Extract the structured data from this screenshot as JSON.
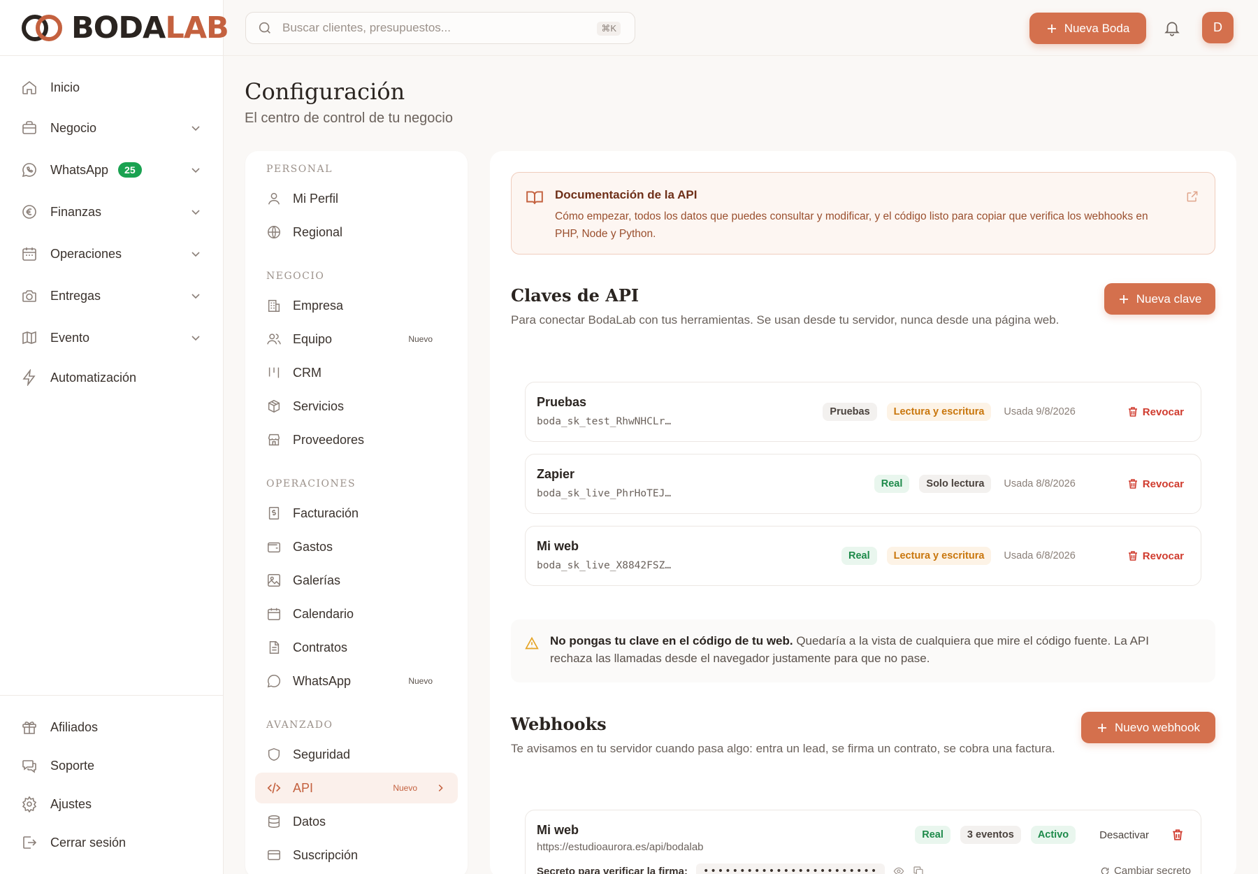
{
  "brand": {
    "name_part1": "BODA",
    "name_part2": "LAB",
    "accent": "#d4704d"
  },
  "search": {
    "placeholder": "Buscar clientes, presupuestos...",
    "shortcut": "⌘K"
  },
  "topbar": {
    "new_wedding_label": "Nueva Boda",
    "avatar_initial": "D"
  },
  "sidebar": {
    "items": [
      {
        "label": "Inicio",
        "icon": "home-icon"
      },
      {
        "label": "Negocio",
        "icon": "briefcase-icon"
      },
      {
        "label": "WhatsApp",
        "icon": "whatsapp-icon",
        "badge": "25"
      },
      {
        "label": "Finanzas",
        "icon": "euro-icon"
      },
      {
        "label": "Operaciones",
        "icon": "calendar-icon"
      },
      {
        "label": "Entregas",
        "icon": "camera-icon"
      },
      {
        "label": "Evento",
        "icon": "map-icon"
      },
      {
        "label": "Automatización",
        "icon": "bolt-icon"
      }
    ],
    "bottom": [
      {
        "label": "Afiliados",
        "icon": "gift-icon"
      },
      {
        "label": "Soporte",
        "icon": "support-icon"
      },
      {
        "label": "Ajustes",
        "icon": "gear-icon"
      },
      {
        "label": "Cerrar sesión",
        "icon": "logout-icon"
      }
    ]
  },
  "page": {
    "title": "Configuración",
    "subtitle": "El centro de control de tu negocio"
  },
  "settings_nav": {
    "sections": [
      {
        "title": "PERSONAL",
        "items": [
          {
            "label": "Mi Perfil"
          },
          {
            "label": "Regional"
          }
        ]
      },
      {
        "title": "NEGOCIO",
        "items": [
          {
            "label": "Empresa"
          },
          {
            "label": "Equipo",
            "tag": "Nuevo"
          },
          {
            "label": "CRM"
          },
          {
            "label": "Servicios"
          },
          {
            "label": "Proveedores"
          }
        ]
      },
      {
        "title": "OPERACIONES",
        "items": [
          {
            "label": "Facturación"
          },
          {
            "label": "Gastos"
          },
          {
            "label": "Galerías"
          },
          {
            "label": "Calendario"
          },
          {
            "label": "Contratos"
          },
          {
            "label": "WhatsApp",
            "tag": "Nuevo"
          }
        ]
      },
      {
        "title": "AVANZADO",
        "items": [
          {
            "label": "Seguridad"
          },
          {
            "label": "API",
            "tag": "Nuevo"
          },
          {
            "label": "Datos"
          },
          {
            "label": "Suscripción"
          }
        ]
      }
    ]
  },
  "doc_banner": {
    "title": "Documentación de la API",
    "description": "Cómo empezar, todos los datos que puedes consultar y modificar, y el código listo para copiar que verifica los webhooks en PHP, Node y Python."
  },
  "api_keys": {
    "title": "Claves de API",
    "description": "Para conectar BodaLab con tus herramientas. Se usan desde tu servidor, nunca desde una página web.",
    "new_label": "Nueva clave",
    "revoke_label": "Revocar",
    "items": [
      {
        "name": "Pruebas",
        "key": "boda_sk_test_RhwNHCLr…",
        "env": "Pruebas",
        "scope": "Lectura y escritura",
        "used": "Usada 9/8/2026"
      },
      {
        "name": "Zapier",
        "key": "boda_sk_live_PhrHoTEJ…",
        "env": "Real",
        "scope": "Solo lectura",
        "used": "Usada 8/8/2026"
      },
      {
        "name": "Mi web",
        "key": "boda_sk_live_X8842FSZ…",
        "env": "Real",
        "scope": "Lectura y escritura",
        "used": "Usada 6/8/2026"
      }
    ]
  },
  "warning": {
    "bold": "No pongas tu clave en el código de tu web.",
    "text": " Quedaría a la vista de cualquiera que mire el código fuente. La API rechaza las llamadas desde el navegador justamente para que no pase."
  },
  "webhooks": {
    "title": "Webhooks",
    "description": "Te avisamos en tu servidor cuando pasa algo: entra un lead, se firma un contrato, se cobra una factura.",
    "new_label": "Nuevo webhook",
    "item": {
      "name": "Mi web",
      "url": "https://estudioaurora.es/api/bodalab",
      "env": "Real",
      "events": "3 eventos",
      "status": "Activo",
      "deactivate_label": "Desactivar",
      "secret_label": "Secreto para verificar la firma:",
      "secret_value": "••••••••••••••••••••••••",
      "rotate_label": "Cambiar secreto"
    }
  }
}
